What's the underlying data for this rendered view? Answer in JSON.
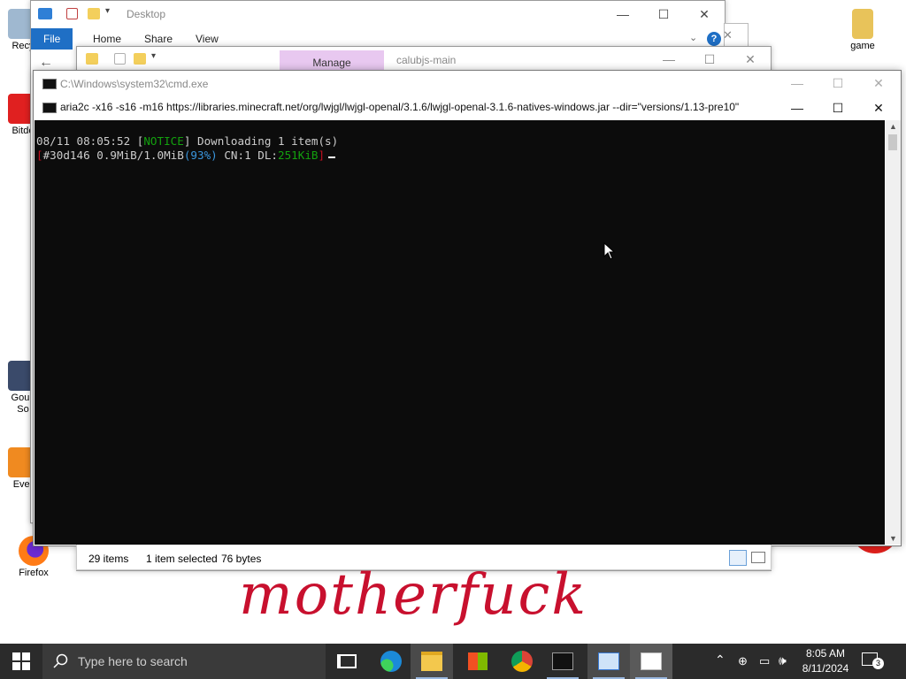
{
  "desktop": {
    "icons_left": [
      {
        "label": "Recy",
        "icon": "recycle-bin-icon"
      },
      {
        "label": "Bitde",
        "icon": "bitdefender-icon"
      },
      {
        "label": "Goun",
        "label2": "So",
        "icon": "app-icon"
      },
      {
        "label": "Ever",
        "icon": "app-icon"
      },
      {
        "label": "Firefox",
        "icon": "firefox-icon"
      }
    ],
    "icon_right": {
      "label": "game",
      "icon": "folder-icon"
    }
  },
  "explorer_back": {
    "title": "Desktop",
    "tabs": [
      "File",
      "Home",
      "Share",
      "View"
    ],
    "help": "?"
  },
  "explorer_mid": {
    "context_tab": "Manage",
    "title": "calubjs-main",
    "status": {
      "items": "29 items",
      "selected": "1 item selected",
      "size": "76 bytes"
    }
  },
  "cmd": {
    "outer_title": "C:\\Windows\\system32\\cmd.exe",
    "inner_title": "aria2c  -x16 -s16 -m16 https://libraries.minecraft.net/org/lwjgl/lwjgl-openal/3.1.6/lwjgl-openal-3.1.6-natives-windows.jar --dir=\"versions/1.13-pre10\"",
    "line1": {
      "prefix": "08/11 08:05:52 [",
      "tag": "NOTICE",
      "suffix": "] Downloading 1 item(s)"
    },
    "line2": {
      "open": "[",
      "body": "#30d146 0.9MiB/1.0MiB",
      "pct": "(93%)",
      "cn": " CN:1 DL:",
      "dl": "251KiB",
      "close": "]"
    }
  },
  "overlay": {
    "text": "motherfuck"
  },
  "taskbar": {
    "search_placeholder": "Type here to search",
    "time": "8:05 AM",
    "date": "8/11/2024",
    "notification_count": "3"
  },
  "colors": {
    "console_bg": "#0c0c0c",
    "taskbar_bg": "#2b2b2b",
    "file_tab": "#1f6fc5",
    "manage_tab": "#e8c8f0"
  }
}
